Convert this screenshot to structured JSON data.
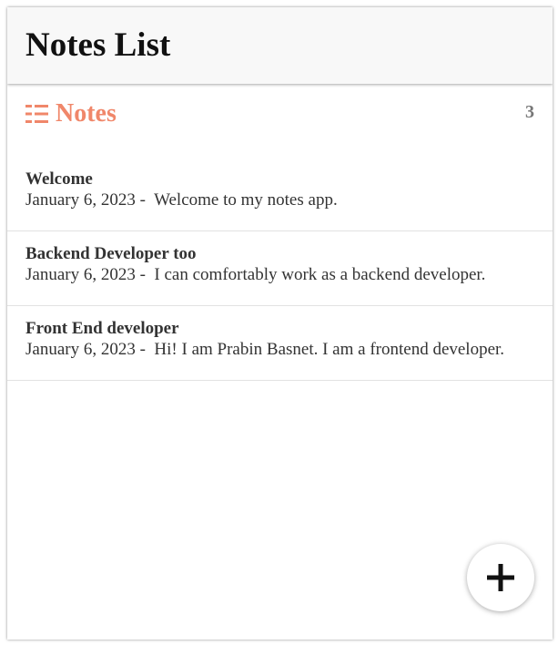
{
  "app": {
    "title": "Notes List"
  },
  "notes_section": {
    "title": "Notes",
    "count": "3",
    "icon": "list-icon",
    "accent_color": "#f0876a"
  },
  "notes": [
    {
      "title": "Welcome",
      "date": "January 6, 2023",
      "separator": " -  ",
      "preview": "Welcome to my notes app."
    },
    {
      "title": "Backend Developer too",
      "date": "January 6, 2023",
      "separator": " -  ",
      "preview": "I can comfortably work as a backend developer."
    },
    {
      "title": "Front End developer",
      "date": "January 6, 2023",
      "separator": " -  ",
      "preview": "Hi! I am Prabin Basnet. I am a frontend developer."
    }
  ],
  "fab": {
    "icon": "plus-icon"
  }
}
